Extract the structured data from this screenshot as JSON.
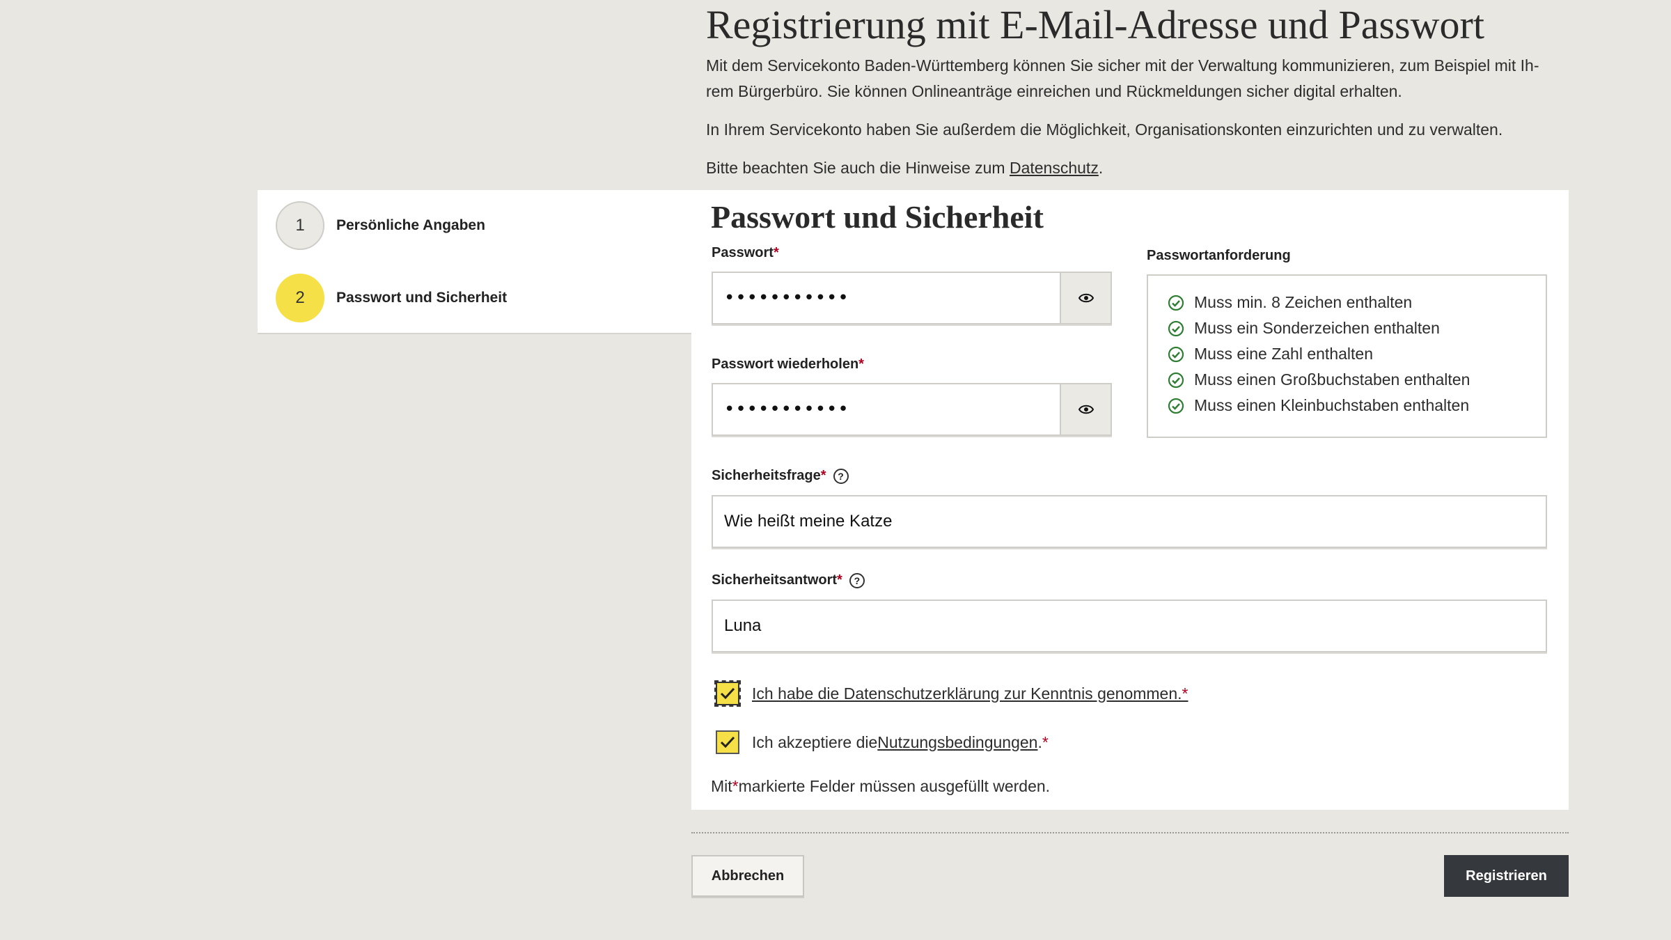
{
  "header": {
    "title": "Registrierung mit E-Mail-Adresse und Passwort",
    "intro_line1": "Mit dem Servicekonto Baden-Württemberg können Sie sicher mit der Verwaltung kommunizieren, zum Beispiel mit Ih-",
    "intro_line2": "rem Bürgerbüro. Sie können Onlineanträge einreichen und Rückmeldungen sicher digital erhalten.",
    "intro_para2": "In Ihrem Servicekonto haben Sie außerdem die Möglichkeit, Organisationskonten einzurichten und zu verwalten.",
    "intro_para3_prefix": "Bitte beachten Sie auch die Hinweise zum ",
    "intro_para3_link": "Datenschutz",
    "intro_para3_suffix": "."
  },
  "stepper": {
    "steps": [
      {
        "number": "1",
        "label": "Persönliche Angaben"
      },
      {
        "number": "2",
        "label": "Passwort und Sicherheit"
      }
    ]
  },
  "form": {
    "section_title": "Passwort und Sicherheit",
    "required_marker": "*",
    "password": {
      "label": "Passwort",
      "value": "•••••••••••"
    },
    "password_repeat": {
      "label": "Passwort wiederholen",
      "value": "•••••••••••"
    },
    "requirements": {
      "title": "Passwortanforderung",
      "items": [
        "Muss min. 8 Zeichen enthalten",
        "Muss ein Sonderzeichen enthalten",
        "Muss eine Zahl enthalten",
        "Muss einen Großbuchstaben enthalten",
        "Muss einen Kleinbuchstaben enthalten"
      ],
      "check_color": "#2e7d32"
    },
    "security_question": {
      "label": "Sicherheitsfrage",
      "value": "Wie heißt meine Katze"
    },
    "security_answer": {
      "label": "Sicherheitsantwort",
      "value": "Luna"
    },
    "privacy_checkbox": {
      "label": "Ich habe die Datenschutzerklärung zur Kenntnis genommen.",
      "checked": true
    },
    "terms_checkbox": {
      "prefix": "Ich akzeptiere die ",
      "link": "Nutzungsbedingungen",
      "suffix": ".",
      "checked": true
    },
    "required_note_prefix": "Mit ",
    "required_note_suffix": " markierte Felder müssen ausgefüllt werden."
  },
  "buttons": {
    "cancel": "Abbrechen",
    "register": "Registrieren"
  },
  "colors": {
    "accent_yellow": "#f5e047",
    "primary_button": "#35383c",
    "required_red": "#b00020"
  }
}
